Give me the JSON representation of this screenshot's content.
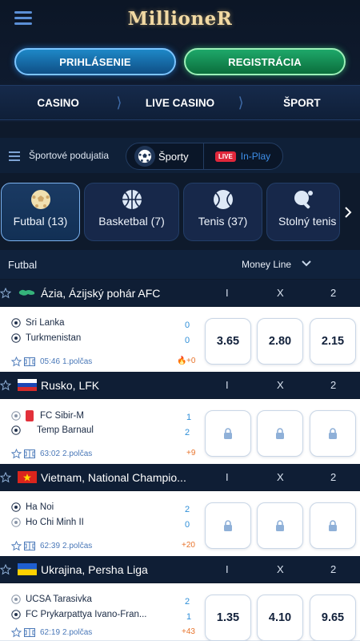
{
  "header": {
    "logo": "MillioneR",
    "login_label": "PRIHLÁSENIE",
    "register_label": "REGISTRÁCIA",
    "nav": [
      "CASINO",
      "LIVE CASINO",
      "ŠPORT"
    ]
  },
  "subnav": {
    "title": "Športové podujatia",
    "sporty_label": "Športy",
    "live_badge": "LIVE",
    "inplay_label": "In-Play"
  },
  "sports": [
    {
      "label": "Futbal (13)",
      "icon": "soccer-ball-icon",
      "active": true
    },
    {
      "label": "Basketbal (7)",
      "icon": "basketball-icon",
      "active": false
    },
    {
      "label": "Tenis (37)",
      "icon": "tennis-ball-icon",
      "active": false
    },
    {
      "label": "Stolný tenis",
      "icon": "table-tennis-icon",
      "active": false
    }
  ],
  "table": {
    "title": "Futbal",
    "market": "Money Line",
    "cols": [
      "I",
      "X",
      "2"
    ]
  },
  "leagues": [
    {
      "name": "Ázia, Ázijský pohár AFC",
      "flag": "asia-flag-icon",
      "match": {
        "team1": "Sri Lanka",
        "team2": "Turkmenistan",
        "score1": "0",
        "score2": "0",
        "time": "05:46",
        "period": "1.polčas",
        "extra": "+0",
        "odds": [
          "3.65",
          "2.80",
          "2.15"
        ],
        "locked": false
      }
    },
    {
      "name": "Rusko, LFK",
      "flag": "russia-flag-icon",
      "match": {
        "team1": "FC Sibir-M",
        "team2": "Temp Barnaul",
        "score1": "1",
        "score2": "2",
        "time": "63:02",
        "period": "2.polčas",
        "extra": "+9",
        "odds": [],
        "locked": true
      }
    },
    {
      "name": "Vietnam, National Champio...",
      "flag": "vietnam-flag-icon",
      "match": {
        "team1": "Ha Noi",
        "team2": "Ho Chi Minh II",
        "score1": "2",
        "score2": "0",
        "time": "62:39",
        "period": "2.polčas",
        "extra": "+20",
        "odds": [],
        "locked": true
      }
    },
    {
      "name": "Ukrajina, Persha Liga",
      "flag": "ukraine-flag-icon",
      "match": {
        "team1": "UCSA Tarasivka",
        "team2": "FC Prykarpattya Ivano-Fran...",
        "score1": "2",
        "score2": "1",
        "time": "62:19",
        "period": "2.polčas",
        "extra": "+43",
        "odds": [
          "1.35",
          "4.10",
          "9.65"
        ],
        "locked": false
      }
    }
  ],
  "colors": {
    "accent": "#3d8ee8",
    "login": "#1e88c7",
    "register": "#1ea86a",
    "live": "#e0273b"
  }
}
